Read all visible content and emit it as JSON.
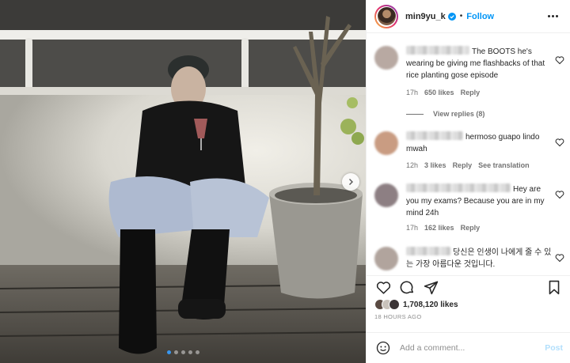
{
  "post": {
    "username": "min9yu_k",
    "separator": "•",
    "follow_label": "Follow",
    "more_icon": "more-horizontal-icon",
    "verified_icon": "verified-badge-icon",
    "carousel": {
      "total": 5,
      "active": 1
    }
  },
  "comments": [
    {
      "text": "The BOOTS he's wearing be giving me flashbacks of that rice planting gose episode",
      "time": "17h",
      "likes": "650 likes",
      "reply": "Reply",
      "avatar_color": "#b8a9a2"
    },
    {
      "text": "hermoso guapo lindo mwah",
      "time": "12h",
      "likes": "3 likes",
      "reply": "Reply",
      "translate": "See translation",
      "avatar_color": "#c99c82"
    },
    {
      "text": "Hey are you my exams? Because you are in my mind 24h",
      "time": "17h",
      "likes": "162 likes",
      "reply": "Reply",
      "avatar_color": "#8d7f83"
    },
    {
      "text": "당신은 인생이 나에게 줄 수 있는 가장 아름다운 것입니다.",
      "avatar_color": "#b1a49d"
    }
  ],
  "view_replies": "View replies (8)",
  "likes": {
    "count": "1,708,120 likes",
    "avatar_colors": [
      "#5a4a42",
      "#c9c2bb",
      "#3b3436"
    ]
  },
  "time_ago": "18 HOURS AGO",
  "add_comment": {
    "placeholder": "Add a comment...",
    "post_label": "Post"
  },
  "colors": {
    "accent": "#0095f6",
    "post_disabled": "#b2dffc",
    "text": "#262626",
    "muted": "#737373"
  }
}
